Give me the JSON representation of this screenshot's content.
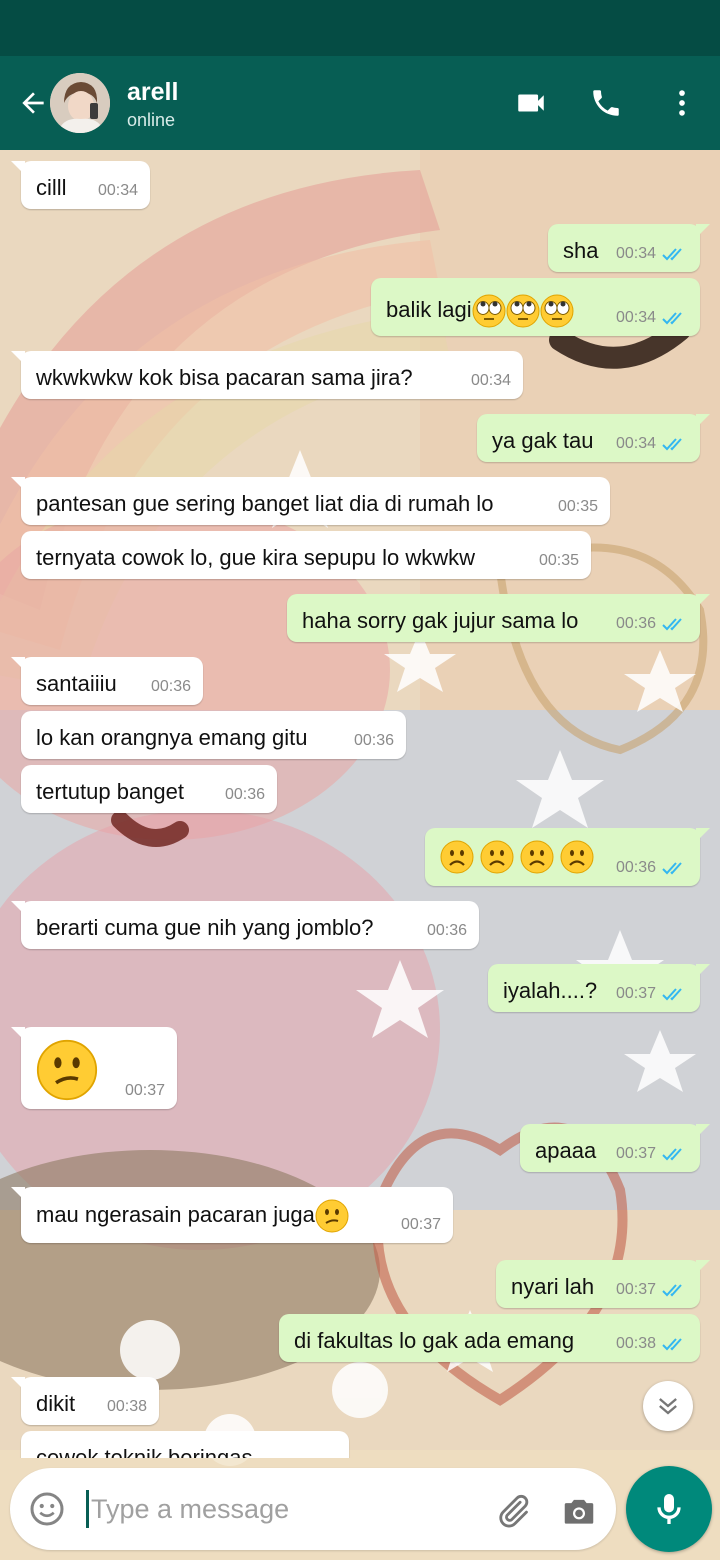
{
  "header": {
    "contact_name": "arell",
    "contact_status": "online",
    "back_icon": "arrow-left-icon",
    "video_icon": "video-call-icon",
    "call_icon": "phone-icon",
    "menu_icon": "more-vert-icon",
    "bar_color": "#075e54"
  },
  "messages": [
    {
      "dir": "in",
      "text": "cilll",
      "time": "00:34"
    },
    {
      "dir": "out",
      "text": "sha",
      "time": "00:34",
      "status": "read"
    },
    {
      "dir": "out",
      "text": "balik lagi",
      "emoji": [
        "face-with-rolling-eyes",
        "face-with-rolling-eyes",
        "face-with-rolling-eyes"
      ],
      "time": "00:34",
      "status": "read"
    },
    {
      "dir": "in",
      "text": "wkwkwkw kok bisa pacaran sama jira?",
      "time": "00:34"
    },
    {
      "dir": "out",
      "text": "ya gak tau",
      "time": "00:34",
      "status": "read"
    },
    {
      "dir": "in",
      "text": "pantesan gue sering banget liat dia di rumah lo",
      "time": "00:35"
    },
    {
      "dir": "in",
      "text": "ternyata cowok lo, gue kira sepupu lo wkwkw",
      "time": "00:35"
    },
    {
      "dir": "out",
      "text": "haha sorry gak jujur sama lo",
      "time": "00:36",
      "status": "read"
    },
    {
      "dir": "in",
      "text": "santaiiiu",
      "time": "00:36"
    },
    {
      "dir": "in",
      "text": "lo kan orangnya emang gitu",
      "time": "00:36"
    },
    {
      "dir": "in",
      "text": "tertutup banget",
      "time": "00:36"
    },
    {
      "dir": "out",
      "text": "",
      "emoji": [
        "frowning-face",
        "frowning-face",
        "frowning-face",
        "frowning-face"
      ],
      "time": "00:36",
      "status": "read"
    },
    {
      "dir": "in",
      "text": "berarti cuma gue nih yang jomblo?",
      "time": "00:36"
    },
    {
      "dir": "out",
      "text": "iyalah....?",
      "time": "00:37",
      "status": "read"
    },
    {
      "dir": "in",
      "text": "",
      "emoji": [
        "confused-face"
      ],
      "time": "00:37"
    },
    {
      "dir": "out",
      "text": "apaaa",
      "time": "00:37",
      "status": "read"
    },
    {
      "dir": "in",
      "text": "mau ngerasain pacaran juga",
      "emoji": [
        "confused-face"
      ],
      "time": "00:37"
    },
    {
      "dir": "out",
      "text": "nyari lah",
      "time": "00:37",
      "status": "read"
    },
    {
      "dir": "out",
      "text": "di fakultas lo gak ada emang",
      "time": "00:38",
      "status": "read"
    },
    {
      "dir": "in",
      "text": "dikit",
      "time": "00:38"
    },
    {
      "dir": "in",
      "text": "cewek teknik beringas",
      "time": ""
    }
  ],
  "input": {
    "placeholder": "Type a message",
    "value": "",
    "emoji_icon": "emoji-icon",
    "attach_icon": "paperclip-icon",
    "camera_icon": "camera-icon",
    "mic_icon": "microphone-icon",
    "scroll_icon": "double-chevron-down-icon"
  },
  "colors": {
    "incoming_bubble": "#ffffff",
    "outgoing_bubble": "#dcf8c6",
    "read_ticks": "#34b7f1",
    "mic_button": "#00897b"
  }
}
